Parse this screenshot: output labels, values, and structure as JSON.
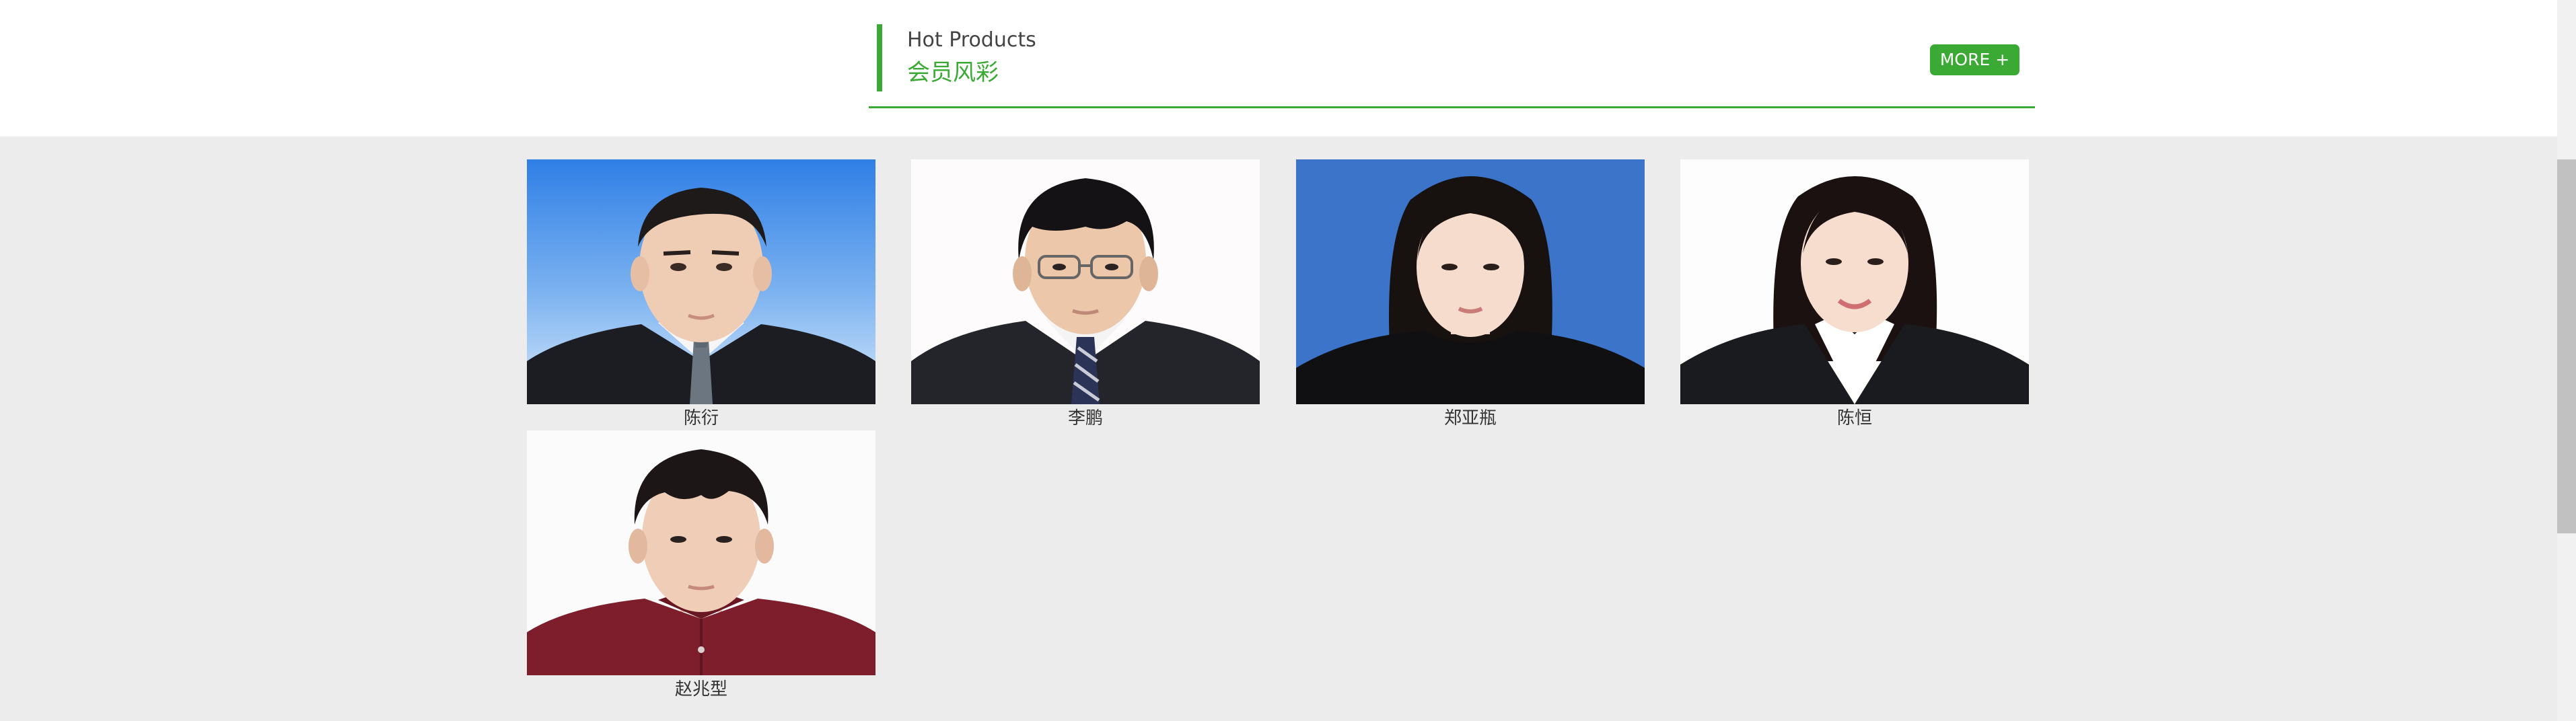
{
  "section": {
    "title_en": "Hot Products",
    "title_cn": "会员风彩",
    "more_label": "MORE +"
  },
  "members": [
    {
      "name": "陈衍",
      "background": "blue-gradient",
      "attire": "black suit, grey tie"
    },
    {
      "name": "李鹏",
      "background": "white",
      "attire": "black suit, striped tie, glasses"
    },
    {
      "name": "郑亚瓶",
      "background": "blue",
      "attire": "black top"
    },
    {
      "name": "陈恒",
      "background": "white",
      "attire": "black suit, white shirt"
    },
    {
      "name": "赵兆型",
      "background": "white",
      "attire": "burgundy shirt"
    }
  ],
  "colors": {
    "accent": "#3aaa35",
    "gallery_bg": "#ececec"
  }
}
